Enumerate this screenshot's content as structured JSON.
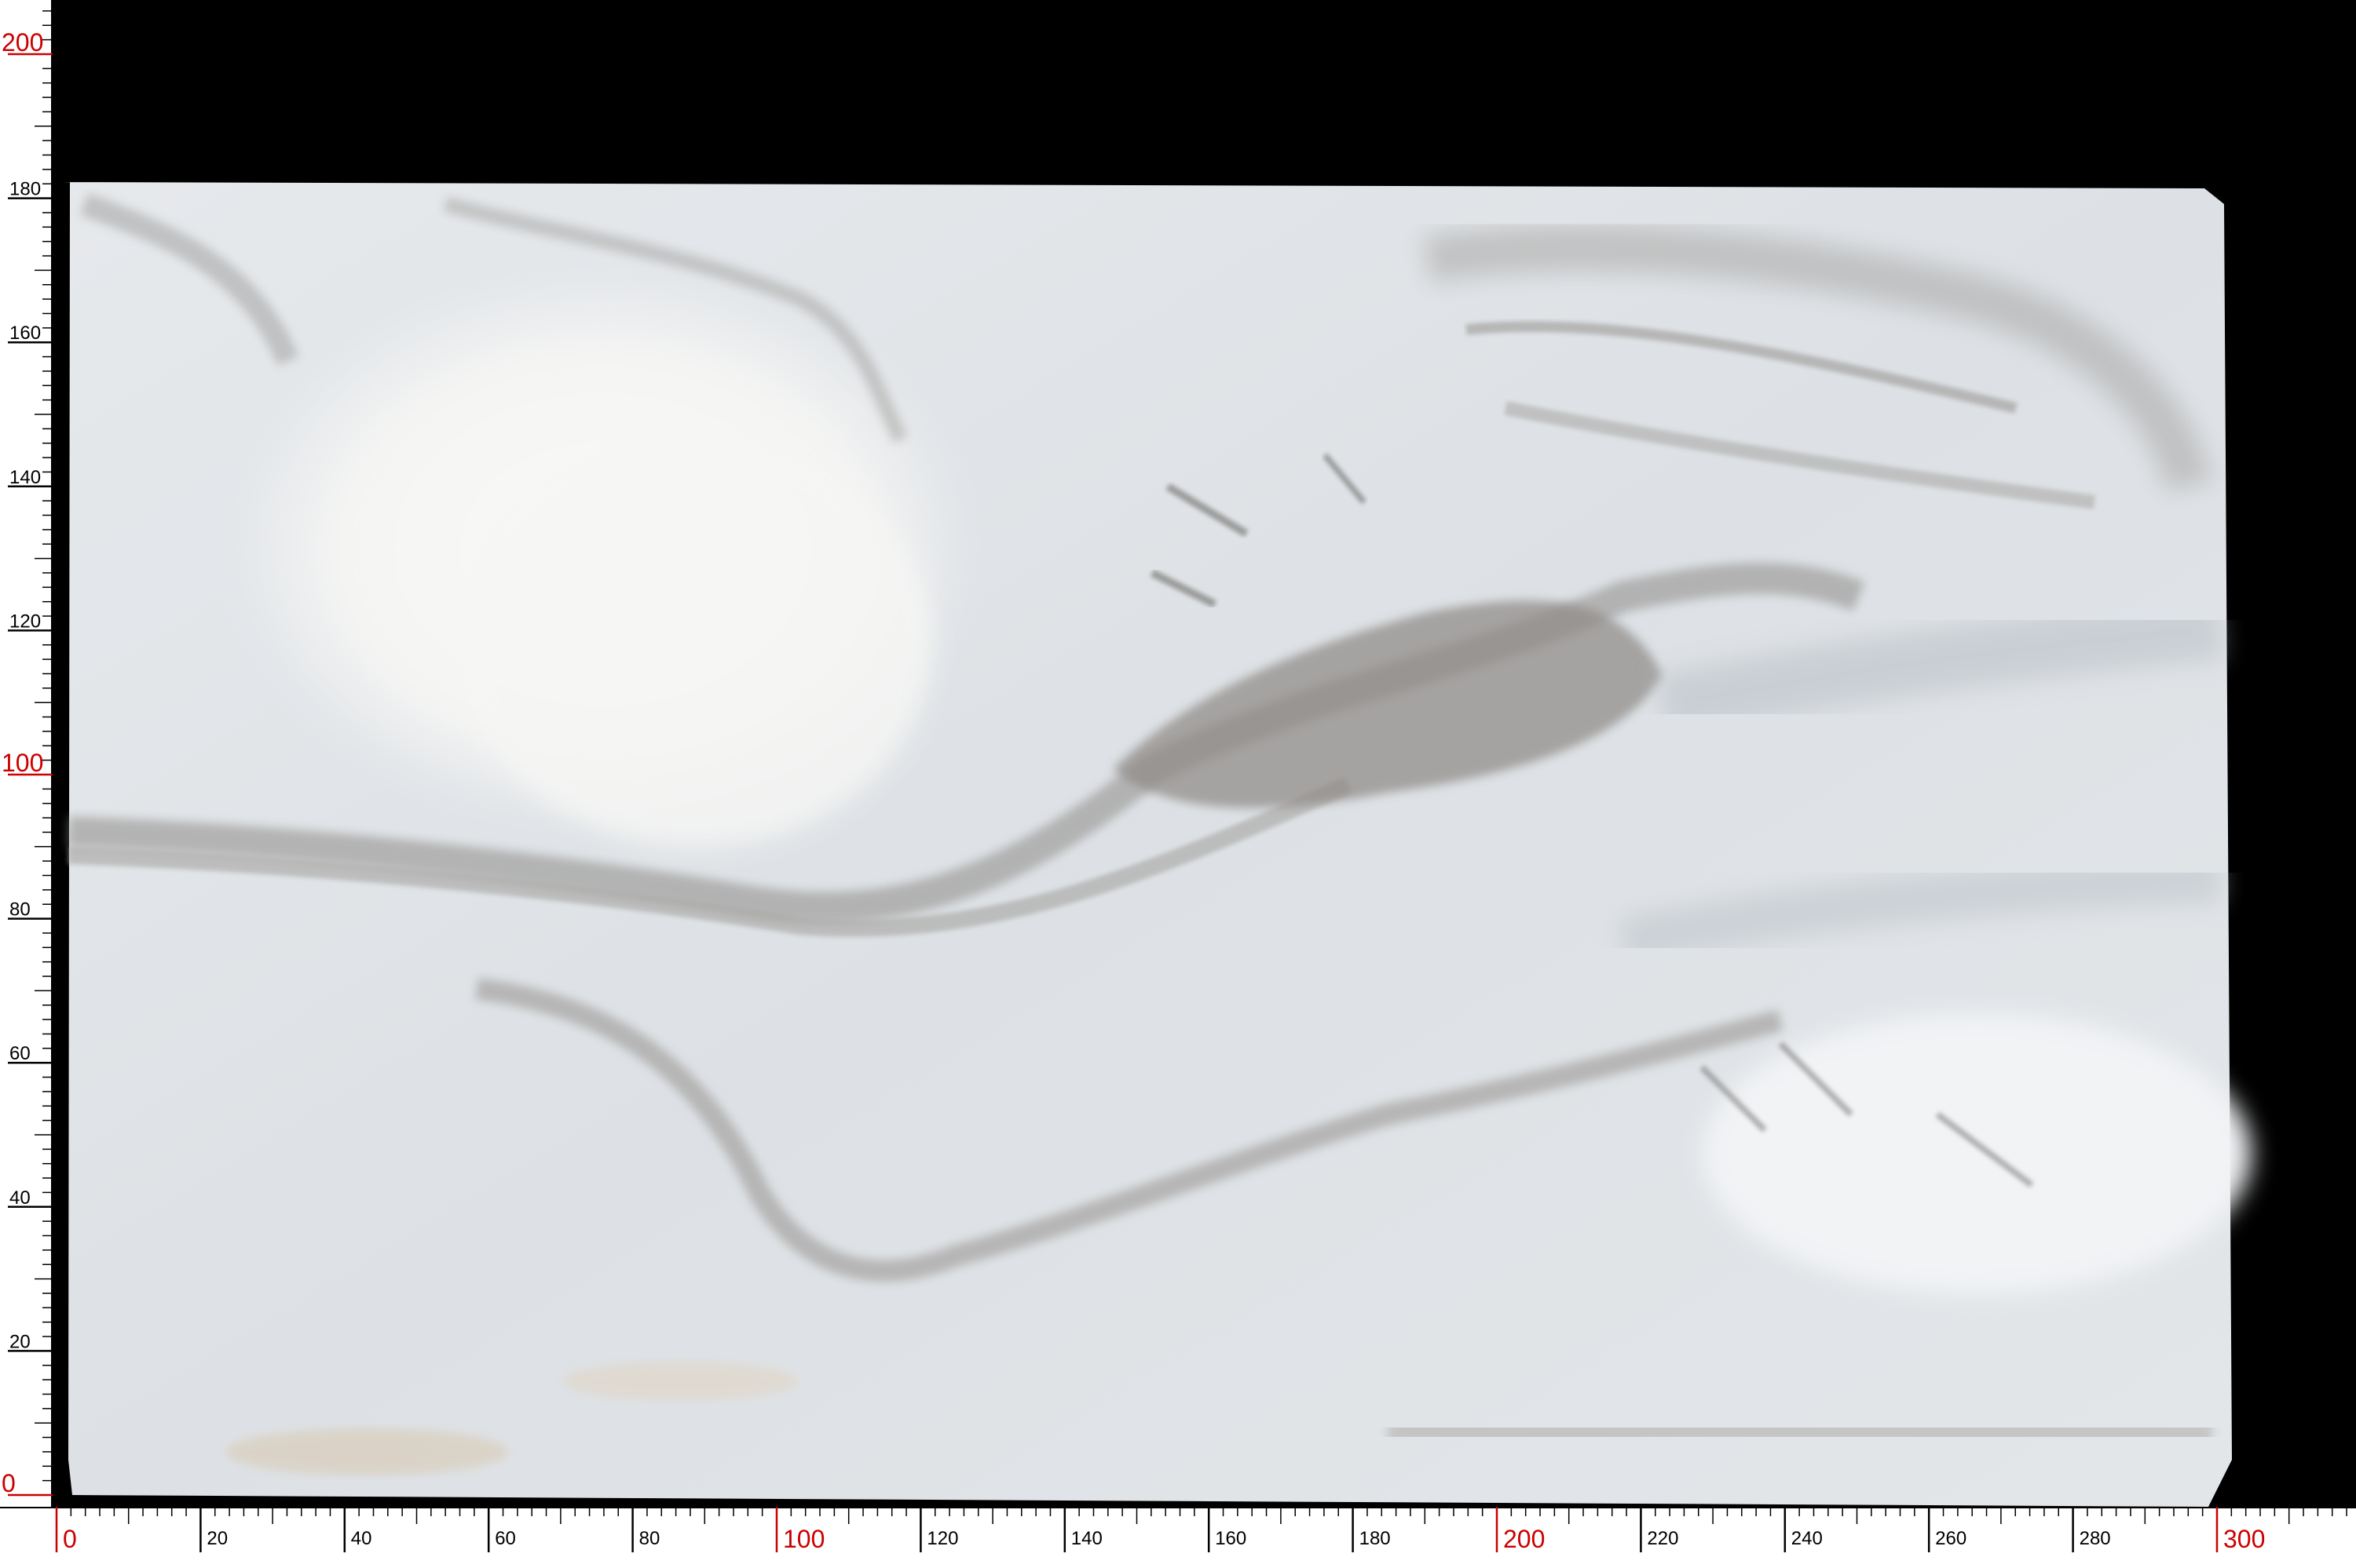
{
  "image": {
    "subject": "marble slab photo",
    "background_color": "#000000",
    "slab_base_color": "#dfe3e6",
    "vein_color": "#8d8b88",
    "ruler_major_color": "#cc0000",
    "ruler_minor_color": "#000000"
  },
  "rulers": {
    "bottom": {
      "labels": [
        "0",
        "20",
        "40",
        "60",
        "80",
        "100",
        "120",
        "140",
        "160",
        "180",
        "200",
        "220",
        "240",
        "260",
        "280",
        "300"
      ],
      "red_labels": [
        "0",
        "100",
        "200",
        "300"
      ]
    },
    "left": {
      "labels": [
        "0",
        "20",
        "40",
        "60",
        "80",
        "100",
        "120",
        "140",
        "160",
        "180",
        "200"
      ],
      "red_labels": [
        "0",
        "100",
        "200"
      ]
    }
  }
}
